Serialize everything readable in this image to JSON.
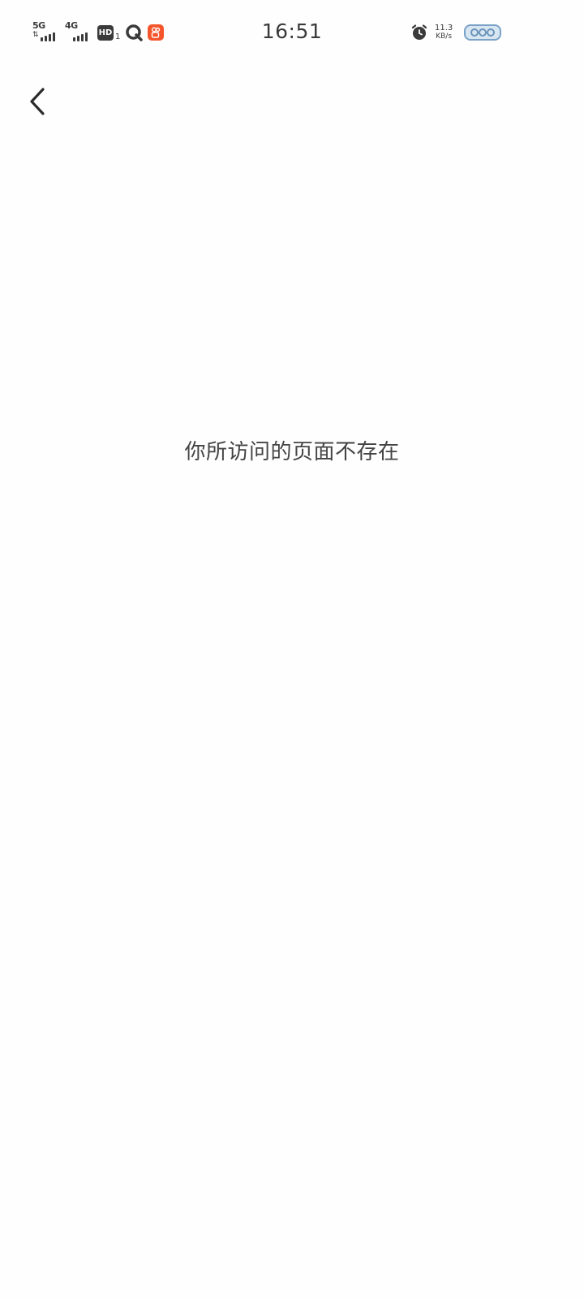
{
  "status_bar": {
    "net1_label": "5G",
    "net2_label": "4G",
    "hd_label": "HD",
    "hd_sub": "1",
    "time": "16:51",
    "speed_value": "11.3",
    "speed_unit": "KB/s",
    "icons": [
      "signal-5g-icon",
      "signal-4g-icon",
      "hd-voice-icon",
      "q-app-icon",
      "kuaishou-app-icon",
      "alarm-icon",
      "battery-icon"
    ],
    "accent_app_color": "#f5552b"
  },
  "nav": {
    "back_icon": "chevron-left-icon"
  },
  "main": {
    "message": "你所访问的页面不存在"
  }
}
